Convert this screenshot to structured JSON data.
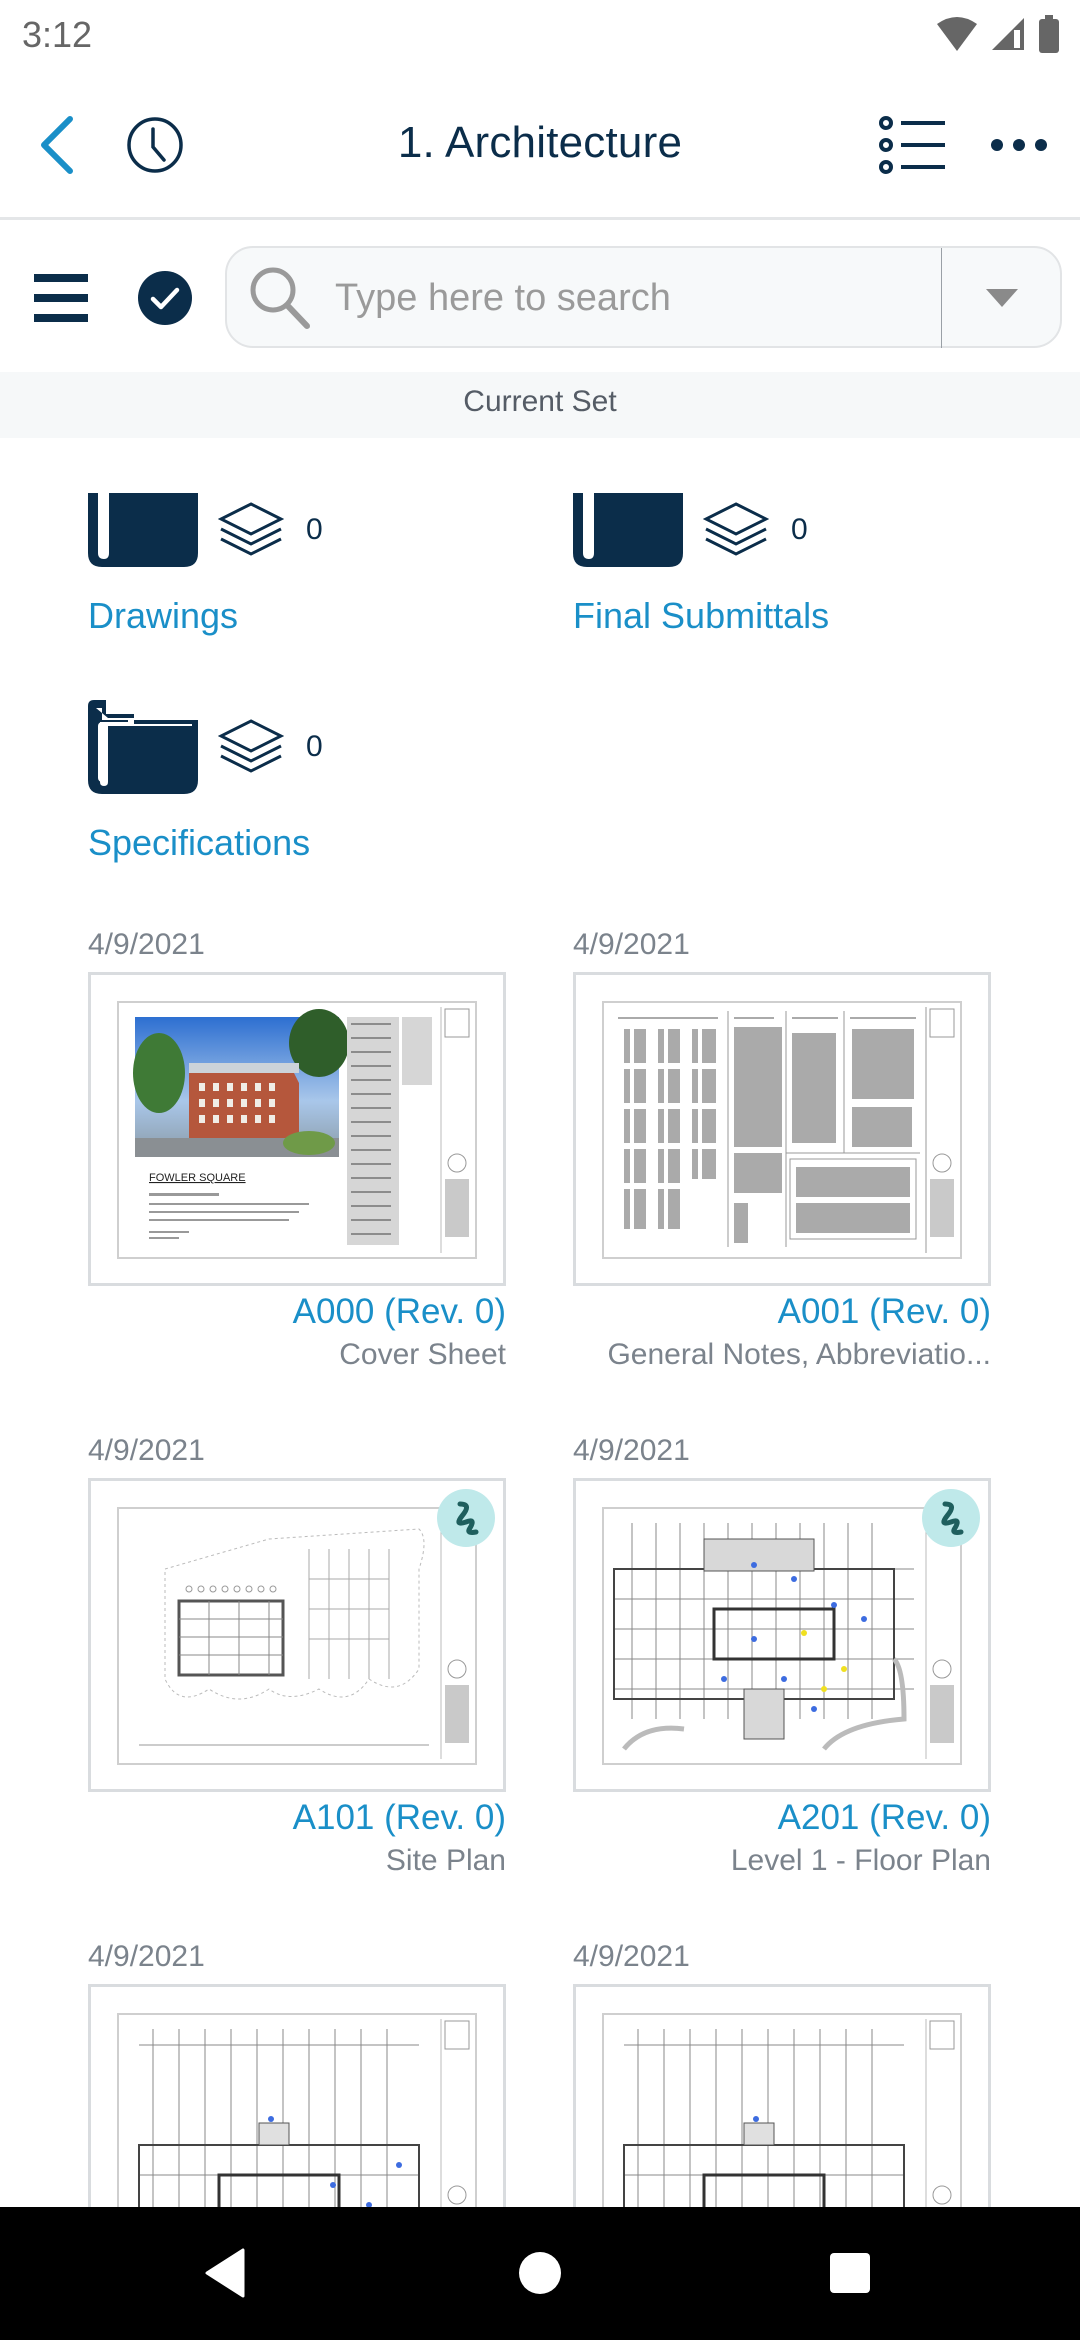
{
  "status_bar": {
    "time": "3:12",
    "icons": [
      "wifi-icon",
      "cell-signal-icon",
      "battery-icon"
    ]
  },
  "header": {
    "title": "1. Architecture",
    "left_icons": [
      "back-chevron-icon",
      "history-clock-icon"
    ],
    "right_icons": [
      "list-view-icon",
      "more-dots-icon"
    ]
  },
  "toolbar": {
    "menu_icon": "hamburger-menu-icon",
    "select_icon": "check-circle-icon",
    "search": {
      "placeholder": "Type here to search",
      "value": "",
      "icon": "search-icon",
      "dropdown_icon": "caret-down-icon"
    }
  },
  "set_label": "Current Set",
  "folders": [
    {
      "label": "Drawings",
      "count": "0",
      "icon": "folder-icon"
    },
    {
      "label": "Final Submittals",
      "count": "0",
      "icon": "folder-icon"
    },
    {
      "label": "Specifications",
      "count": "0",
      "icon": "folder-icon"
    }
  ],
  "sheets": [
    {
      "date": "4/9/2021",
      "code": "A000 (Rev. 0)",
      "name": "Cover Sheet",
      "thumb_title": "FOWLER SQUARE",
      "has_markup": false
    },
    {
      "date": "4/9/2021",
      "code": "A001 (Rev. 0)",
      "name": "General Notes, Abbreviatio...",
      "has_markup": false
    },
    {
      "date": "4/9/2021",
      "code": "A101 (Rev. 0)",
      "name": "Site Plan",
      "has_markup": true
    },
    {
      "date": "4/9/2021",
      "code": "A201 (Rev. 0)",
      "name": "Level 1 - Floor Plan",
      "has_markup": true
    },
    {
      "date": "4/9/2021",
      "code": "",
      "name": "",
      "has_markup": false
    },
    {
      "date": "4/9/2021",
      "code": "",
      "name": "",
      "has_markup": false
    }
  ],
  "colors": {
    "primary_dark": "#0b2d4a",
    "accent_blue": "#1a8fc8",
    "muted_text": "#7b838c",
    "markup_badge": "#bfe9ea"
  },
  "nav_bar": {
    "buttons": [
      "nav-back-icon",
      "nav-home-icon",
      "nav-recents-icon"
    ]
  }
}
